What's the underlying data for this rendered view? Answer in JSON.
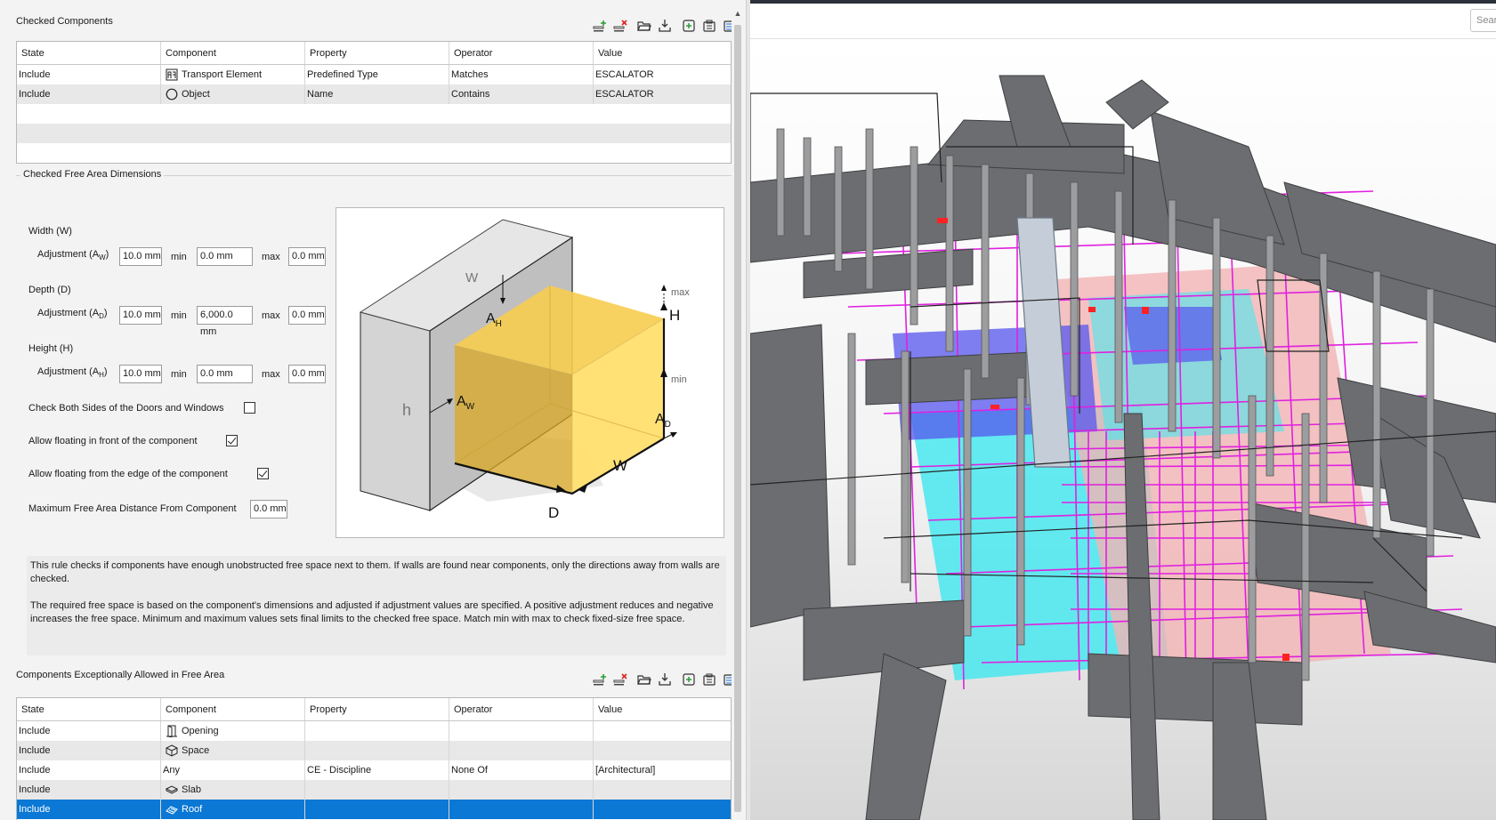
{
  "checked_components": {
    "title": "Checked Components",
    "columns": [
      "State",
      "Component",
      "Property",
      "Operator",
      "Value"
    ],
    "rows": [
      {
        "state": "Include",
        "component": "Transport Element",
        "icon": "transport-element-icon",
        "property": "Predefined Type",
        "operator": "Matches",
        "value": "ESCALATOR"
      },
      {
        "state": "Include",
        "component": "Object",
        "icon": "object-icon",
        "property": "Name",
        "operator": "Contains",
        "value": "ESCALATOR"
      }
    ]
  },
  "dimensions": {
    "title": "Checked Free Area Dimensions",
    "width_label": "Width (W)",
    "depth_label": "Depth (D)",
    "height_label": "Height (H)",
    "adj_label": "Adjustment (A",
    "adj_w_sub": "W",
    "adj_d_sub": "D",
    "adj_h_sub": "H",
    "adj_close": ")",
    "min_label": "min",
    "max_label": "max",
    "width": {
      "adjustment": "10.0 mm",
      "min": "0.0 mm",
      "max": "0.0 mm"
    },
    "depth": {
      "adjustment": "10.0 mm",
      "min": "6,000.0 mm",
      "max": "0.0 mm"
    },
    "height": {
      "adjustment": "10.0 mm",
      "min": "0.0 mm",
      "max": "0.0 mm"
    },
    "check_both_sides_label": "Check Both Sides of the Doors and Windows",
    "check_both_sides": false,
    "allow_floating_front_label": "Allow floating in front of the component",
    "allow_floating_front": true,
    "allow_floating_edge_label": "Allow floating from the edge of the component",
    "allow_floating_edge": true,
    "max_distance_label": "Maximum Free Area Distance From Component",
    "max_distance": "0.0 mm"
  },
  "diagram": {
    "w": "W",
    "h": "h",
    "ah": "A",
    "ah_sub": "H",
    "aw": "A",
    "aw_sub": "W",
    "ad": "A",
    "ad_sub": "D",
    "H": "H",
    "W": "W",
    "D": "D",
    "max": "max",
    "min": "min",
    "colors": {
      "box": "#f6c945",
      "wall": "#d9d9d9"
    }
  },
  "description": {
    "p1": "This rule checks if components have enough unobstructed free space next to them. If walls are found near components, only the directions away from walls are checked.",
    "p2": "The required free space is based on the component's dimensions and adjusted if adjustment values are specified. A positive adjustment reduces and negative increases the free space. Minimum and maximum values sets final limits to the checked free space. Match min with max to check fixed-size free space."
  },
  "exceptions": {
    "title": "Components Exceptionally Allowed in Free Area",
    "columns": [
      "State",
      "Component",
      "Property",
      "Operator",
      "Value"
    ],
    "rows": [
      {
        "state": "Include",
        "component": "Opening",
        "icon": "opening-icon",
        "property": "",
        "operator": "",
        "value": ""
      },
      {
        "state": "Include",
        "component": "Space",
        "icon": "space-icon",
        "property": "",
        "operator": "",
        "value": ""
      },
      {
        "state": "Include",
        "component": "Any",
        "icon": "",
        "property": "CE - Discipline",
        "operator": "None Of",
        "value": "[Architectural]"
      },
      {
        "state": "Include",
        "component": "Slab",
        "icon": "slab-icon",
        "property": "",
        "operator": "",
        "value": ""
      },
      {
        "state": "Include",
        "component": "Roof",
        "icon": "roof-icon",
        "property": "",
        "operator": "",
        "value": ""
      }
    ],
    "selected_row": 4
  },
  "viewport": {
    "search_placeholder": "Sear",
    "colors": {
      "structure": "#6b6d70",
      "highlight": "#e020e0",
      "space": "#48e8ee",
      "pink": "#f2b4b4",
      "blue": "#5555ee",
      "red": "#ff2222"
    }
  }
}
